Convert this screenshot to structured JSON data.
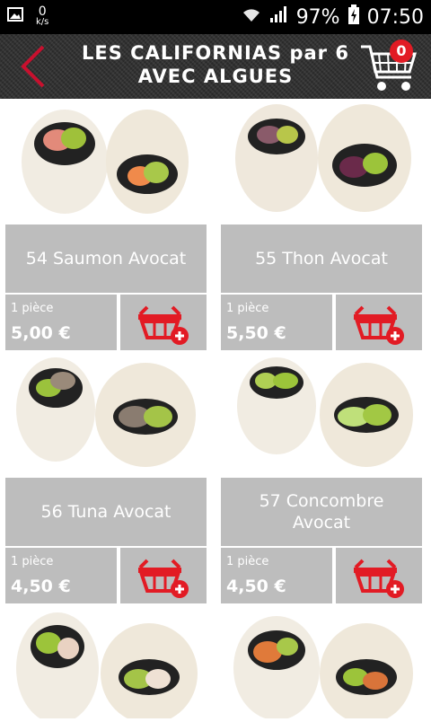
{
  "status": {
    "speed_value": "0",
    "speed_unit": "k/s",
    "battery": "97%",
    "time": "07:50"
  },
  "header": {
    "title_line1": "LES CALIFORNIAS par 6",
    "title_line2": "AVEC ALGUES",
    "cart_count": "0"
  },
  "colors": {
    "accent": "#e21b24",
    "tile": "#bdbdbd"
  },
  "products": [
    {
      "name": "54 Saumon Avocat",
      "unit": "1 pièce",
      "price": "5,00 €"
    },
    {
      "name": "55 Thon Avocat",
      "unit": "1 pièce",
      "price": "5,50 €"
    },
    {
      "name": "56 Tuna Avocat",
      "unit": "1 pièce",
      "price": "4,50 €"
    },
    {
      "name": "57 Concombre Avocat",
      "unit": "1 pièce",
      "price": "4,50 €"
    }
  ]
}
